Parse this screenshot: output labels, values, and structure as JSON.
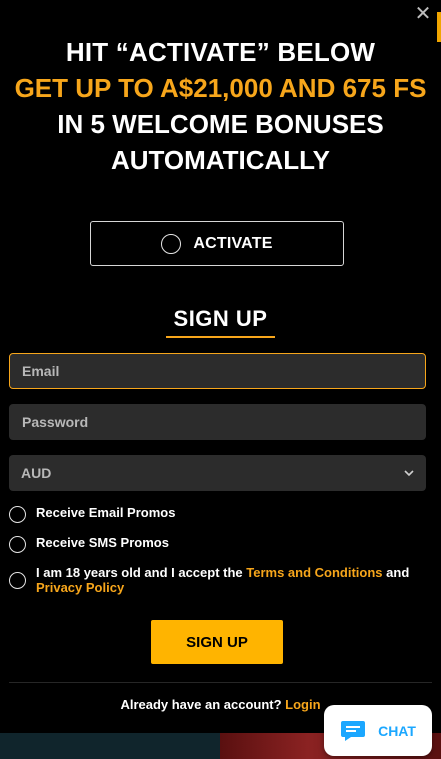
{
  "promo": {
    "line1": "HIT “ACTIVATE” BELOW",
    "line2": "GET UP TO A$21,000 AND 675 FS",
    "line3": "IN 5 WELCOME BONUSES AUTOMATICALLY"
  },
  "activate": {
    "label": "ACTIVATE"
  },
  "signup": {
    "title": "SIGN UP"
  },
  "form": {
    "email_placeholder": "Email",
    "password_placeholder": "Password",
    "currency_selected": "AUD",
    "email_promos_label": "Receive Email Promos",
    "sms_promos_label": "Receive SMS Promos",
    "terms_prefix": "I am 18 years old and I accept the ",
    "terms_link": "Terms and Conditions",
    "terms_and": " and",
    "privacy_link": "Privacy Policy",
    "submit_label": "SIGN UP"
  },
  "login": {
    "prompt": "Already have an account? ",
    "link": "Login"
  },
  "chat": {
    "label": "CHAT"
  },
  "colors": {
    "accent": "#f7a61b",
    "button": "#ffb400",
    "chat_text": "#1ba7ff"
  }
}
